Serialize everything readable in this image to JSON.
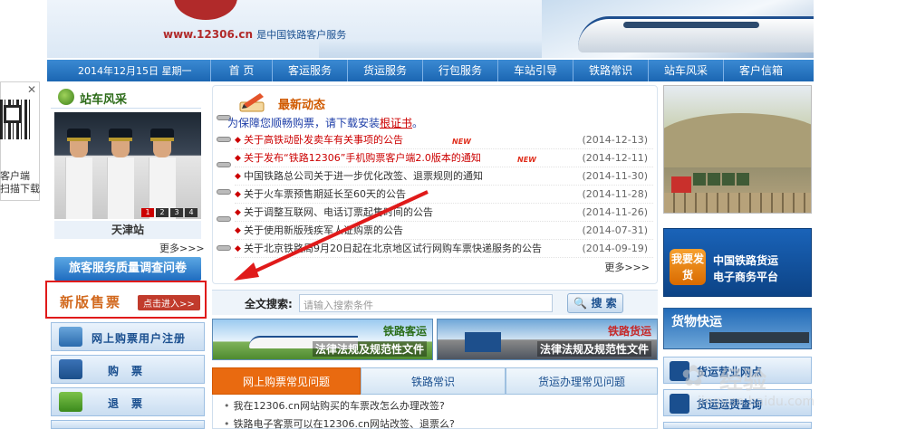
{
  "header": {
    "url": "www.12306.cn",
    "subtitle": "是中国铁路客户服务"
  },
  "nav": {
    "date": "2014年12月15日 星期一",
    "items": [
      "首 页",
      "客运服务",
      "货运服务",
      "行包服务",
      "车站引导",
      "铁路常识",
      "站车风采",
      "客户信箱"
    ]
  },
  "qr": {
    "close": "✕",
    "line1": "客户端",
    "line2": "扫描下载"
  },
  "left": {
    "section_title": "站车风采",
    "photo_tabs": [
      "1",
      "2",
      "3",
      "4"
    ],
    "caption": "天津站",
    "more": "更多>>>",
    "survey": "旅客服务质量调查问卷",
    "new_sale": "新版售票",
    "new_sale_enter": "点击进入>>",
    "buttons": [
      "网上购票用户注册",
      "购票",
      "退票"
    ]
  },
  "news": {
    "title": "最新动态",
    "notice_prefix": "为保障您顺畅购票，请下载安装",
    "notice_link": "根证书",
    "notice_suffix": "。",
    "items": [
      {
        "text": "关于高铁动卧发卖车有关事项的公告",
        "date": "(2014-12-13)",
        "new": true,
        "red": true
      },
      {
        "text": "关于发布“铁路12306”手机购票客户端2.0版本的通知",
        "date": "(2014-12-11)",
        "new": true,
        "red": true
      },
      {
        "text": "中国铁路总公司关于进一步优化改签、退票规则的通知",
        "date": "(2014-11-30)",
        "new": false,
        "red": false
      },
      {
        "text": "关于火车票预售期延长至60天的公告",
        "date": "(2014-11-28)",
        "new": false,
        "red": false
      },
      {
        "text": "关于调整互联网、电话订票起售时间的公告",
        "date": "(2014-11-26)",
        "new": false,
        "red": false
      },
      {
        "text": "关于使用新版残疾军人证购票的公告",
        "date": "(2014-07-31)",
        "new": false,
        "red": false
      },
      {
        "text": "关于北京铁路局9月20日起在北京地区试行网购车票快递服务的公告",
        "date": "(2014-09-19)",
        "new": false,
        "red": false
      }
    ],
    "new_badge": "NEW",
    "more": "更多>>>"
  },
  "search": {
    "label": "全文搜索:",
    "placeholder": "请输入搜索条件",
    "button": "搜 索"
  },
  "banners": [
    {
      "tag": "铁路客运",
      "sub": "法律法规及规范性文件"
    },
    {
      "tag": "铁路货运",
      "sub": "法律法规及规范性文件"
    }
  ],
  "tabs": [
    "网上购票常见问题",
    "铁路常识",
    "货运办理常见问题"
  ],
  "faq": [
    "我在12306.cn网站购买的车票改怎么办理改签?",
    "铁路电子客票可以在12306.cn网站改签、退票么?"
  ],
  "right": {
    "cargo_btn": "我要发货",
    "cargo_l1": "中国铁路货运",
    "cargo_l2": "电子商务平台",
    "express": "货物快运",
    "buttons": [
      "货运营业网点",
      "货运运费查询"
    ]
  },
  "watermark": {
    "text": "经验",
    "url": "jingyan.baidu.com"
  },
  "colors": {
    "nav_blue": "#1b66b2",
    "accent_red": "#e01a1a",
    "news_orange": "#d05a00",
    "active_tab": "#e96a10"
  }
}
